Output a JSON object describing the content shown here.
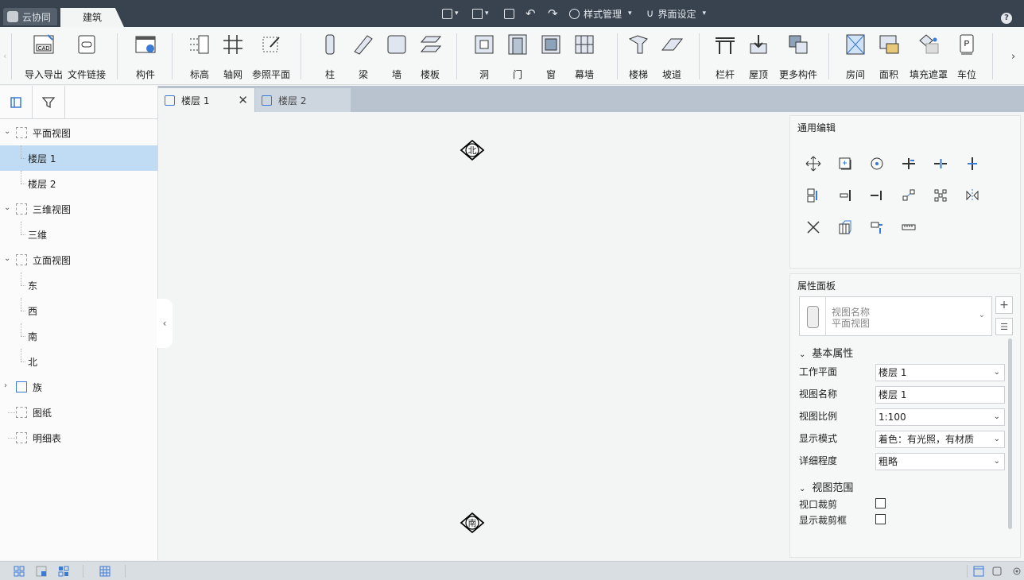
{
  "titlebar": {
    "app_tab": "云协同",
    "main_tab": "建筑",
    "style_menu": "样式管理",
    "ui_menu": "界面设定",
    "help": "?"
  },
  "ribbon": {
    "buttons": [
      {
        "label": "导入导出",
        "icon": "cad-import-icon"
      },
      {
        "label": "文件链接",
        "icon": "file-link-icon"
      },
      {
        "label": "构件",
        "icon": "component-icon"
      },
      {
        "label": "标高",
        "icon": "level-icon"
      },
      {
        "label": "轴网",
        "icon": "grid-icon"
      },
      {
        "label": "参照平面",
        "icon": "reference-plane-icon"
      },
      {
        "label": "柱",
        "icon": "column-icon"
      },
      {
        "label": "梁",
        "icon": "beam-icon"
      },
      {
        "label": "墙",
        "icon": "wall-icon"
      },
      {
        "label": "楼板",
        "icon": "floor-slab-icon"
      },
      {
        "label": "洞",
        "icon": "opening-icon"
      },
      {
        "label": "门",
        "icon": "door-icon"
      },
      {
        "label": "窗",
        "icon": "window-icon"
      },
      {
        "label": "幕墙",
        "icon": "curtain-wall-icon"
      },
      {
        "label": "楼梯",
        "icon": "stair-icon"
      },
      {
        "label": "坡道",
        "icon": "ramp-icon"
      },
      {
        "label": "栏杆",
        "icon": "railing-icon"
      },
      {
        "label": "屋顶",
        "icon": "roof-icon"
      },
      {
        "label": "更多构件",
        "icon": "more-components-icon"
      },
      {
        "label": "房间",
        "icon": "room-icon"
      },
      {
        "label": "面积",
        "icon": "area-icon"
      },
      {
        "label": "填充遮罩",
        "icon": "fill-mask-icon"
      },
      {
        "label": "车位",
        "icon": "parking-icon"
      }
    ]
  },
  "tree": {
    "items": [
      {
        "label": "平面视图",
        "kind": "group"
      },
      {
        "label": "楼层 1",
        "kind": "child",
        "selected": true
      },
      {
        "label": "楼层 2",
        "kind": "child"
      },
      {
        "label": "三维视图",
        "kind": "group"
      },
      {
        "label": "三维",
        "kind": "child"
      },
      {
        "label": "立面视图",
        "kind": "group"
      },
      {
        "label": "东",
        "kind": "child"
      },
      {
        "label": "西",
        "kind": "child"
      },
      {
        "label": "南",
        "kind": "child"
      },
      {
        "label": "北",
        "kind": "child"
      },
      {
        "label": "族",
        "kind": "family"
      },
      {
        "label": "图纸",
        "kind": "leaf"
      },
      {
        "label": "明细表",
        "kind": "leaf"
      }
    ]
  },
  "view_tabs": [
    {
      "label": "楼层 1",
      "active": true
    },
    {
      "label": "楼层 2",
      "active": false
    }
  ],
  "canvas": {
    "north_label": "北",
    "south_label": "南"
  },
  "edit_panel": {
    "title": "通用编辑",
    "tools": [
      "move-icon",
      "copy-icon",
      "rotate-icon",
      "trim-icon",
      "split-icon",
      "offset-icon",
      "array-icon",
      "align-icon",
      "extend-icon",
      "scale-icon",
      "pattern-array-icon",
      "mirror-icon",
      "delete-icon",
      "group-icon",
      "pin-icon",
      "measure-icon"
    ]
  },
  "properties": {
    "title": "属性面板",
    "type_name_label": "视图名称",
    "type_name_value": "平面视图",
    "section_basic": "基本属性",
    "section_range": "视图范围",
    "rows": [
      {
        "label": "工作平面",
        "value": "楼层 1",
        "dropdown": true
      },
      {
        "label": "视图名称",
        "value": "楼层 1",
        "dropdown": false
      },
      {
        "label": "视图比例",
        "value": "1:100",
        "dropdown": true
      },
      {
        "label": "显示模式",
        "value": "着色：有光照，有材质",
        "dropdown": true
      },
      {
        "label": "详细程度",
        "value": "粗略",
        "dropdown": true
      }
    ],
    "checks": [
      {
        "label": "视口裁剪",
        "checked": false
      },
      {
        "label": "显示裁剪框",
        "checked": false
      }
    ]
  }
}
